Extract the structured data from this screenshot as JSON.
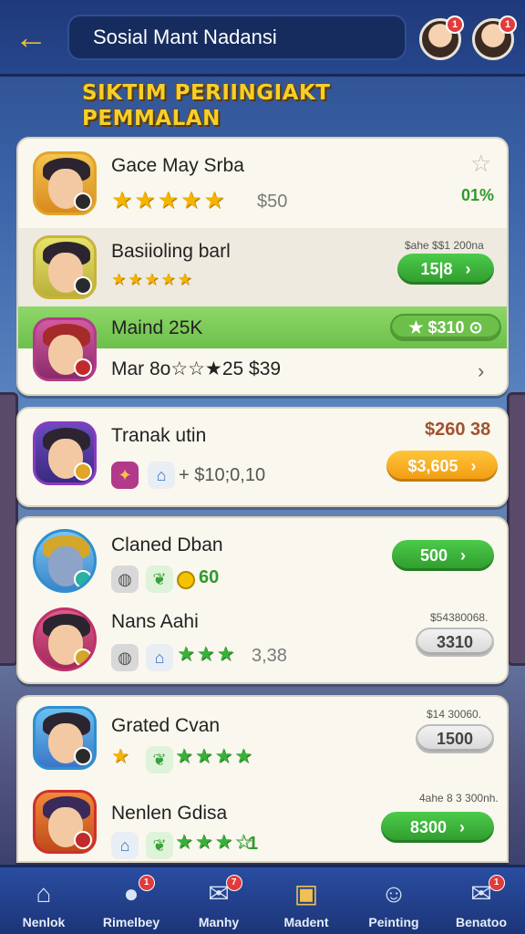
{
  "header": {
    "back_icon": "arrow-left-icon",
    "search_text": "Sosial Mant Nadansi",
    "avatar_badges": [
      "1",
      "1"
    ]
  },
  "section_title": [
    "SIKTIM PERIINGIAKT",
    "PEMMALAN"
  ],
  "card1": {
    "row1": {
      "name": "Gace May Srba",
      "stars": "★★★★★",
      "price": "$50",
      "percent": "01%",
      "star_icon": "star-icon"
    },
    "row2": {
      "name": "Basiioling barl",
      "stars": "★★★★★",
      "small": "$ahe $$1 200na",
      "button": "15|8"
    },
    "row3": {
      "name": "Maind 25K",
      "button": "★ $310 ⊙"
    },
    "row4": {
      "name": "Mar 8o☆☆★25 $39"
    }
  },
  "card2": {
    "row1": {
      "name": "Tranak utin",
      "extra": "+ $10;0,10",
      "price": "$260 38",
      "button": "$3,605"
    }
  },
  "card3": {
    "row1": {
      "name": "Claned Dban",
      "coins": "60",
      "button": "500"
    },
    "row2": {
      "name": "Nans Aahi",
      "extra": "3,38",
      "small": "$54380068.",
      "button": "3310"
    }
  },
  "card4": {
    "row1": {
      "name": "Grated Cvan",
      "small": "$14 30060.",
      "button": "1500"
    },
    "row2": {
      "name": "Nenlen Gdisa",
      "extra": "1",
      "small": "4ahe 8 3 300nh.",
      "button": "8300"
    }
  },
  "nav": [
    {
      "label": "Nenlok",
      "icon": "home-icon",
      "badge": ""
    },
    {
      "label": "Rimelbey",
      "icon": "chat-icon",
      "badge": "1"
    },
    {
      "label": "Manhy",
      "icon": "mail-icon",
      "badge": "7"
    },
    {
      "label": "Madent",
      "icon": "chest-icon",
      "badge": ""
    },
    {
      "label": "Peinting",
      "icon": "profile-icon",
      "badge": ""
    },
    {
      "label": "Benatoo",
      "icon": "message-icon",
      "badge": "1"
    }
  ],
  "colors": {
    "accent_green": "#3db53a",
    "accent_orange": "#f5a81e",
    "header": "#1f3a7a",
    "title_gold": "#f6cf2b"
  }
}
